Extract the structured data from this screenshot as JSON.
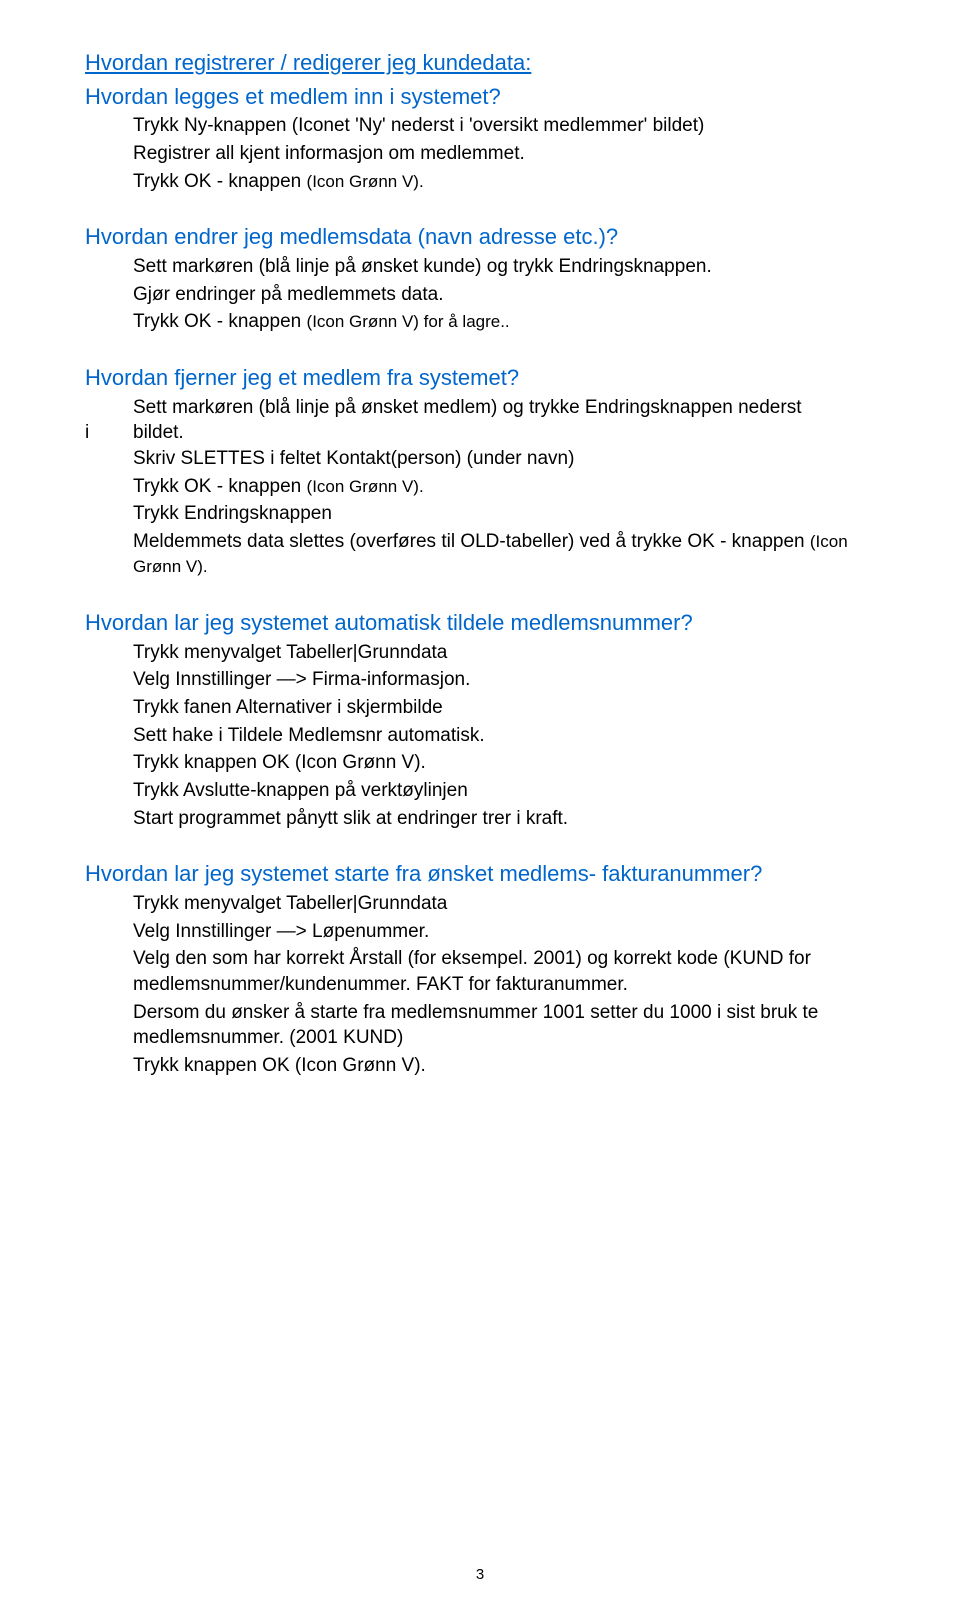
{
  "title": "Hvordan registrerer / redigerer jeg kundedata:",
  "sections": {
    "add": {
      "heading": "Hvordan legges et medlem inn i systemet?",
      "p1": "Trykk Ny-knappen (Iconet 'Ny' nederst i 'oversikt medlemmer' bildet)",
      "p2": "Registrer all kjent informasjon om medlemmet.",
      "p3_a": "Trykk OK - knappen ",
      "p3_b": "(Icon Grønn V)."
    },
    "edit": {
      "heading": "Hvordan endrer jeg medlemsdata (navn adresse etc.)?",
      "p1": "Sett markøren (blå  linje på ønsket kunde) og trykk  Endringsknappen.",
      "p2": "Gjør endringer på medlemmets data.",
      "p3_a": "Trykk OK - knappen ",
      "p3_b": "(Icon Grønn V) for å lagre.."
    },
    "remove": {
      "heading": "Hvordan fjerner jeg et medlem fra systemet?",
      "i_label": "i",
      "p1a": "Sett markøren (blå  linje på ønsket medlem) og trykke Endringsknappen nederst",
      "p1b": "bildet.",
      "p2": "Skriv SLETTES i feltet Kontakt(person) (under navn)",
      "p3_a": "Trykk OK - knappen ",
      "p3_b": "(Icon Grønn V).",
      "p4": "Trykk Endringsknappen",
      "p5_a": "Meldemmets data slettes (overføres til OLD-tabeller) ved å trykke OK - knappen ",
      "p5_b": "(Icon Grønn V)."
    },
    "autonumber": {
      "heading": "Hvordan lar jeg systemet automatisk tildele medlemsnummer?",
      "p1": "Trykk menyvalget Tabeller|Grunndata",
      "p2": "Velg Innstillinger —> Firma-informasjon.",
      "p3": "Trykk fanen Alternativer i skjermbilde",
      "p4": "Sett hake i Tildele Medlemsnr automatisk.",
      "p5": "Trykk knappen OK (Icon Grønn V).",
      "p6": "Trykk Avslutte-knappen på verktøylinjen",
      "p7": "Start programmet pånytt slik at endringer trer i kraft."
    },
    "startnumber": {
      "heading": "Hvordan lar jeg systemet starte fra ønsket medlems-  fakturanummer?",
      "p1": "Trykk menyvalget Tabeller|Grunndata",
      "p2": "Velg Innstillinger —> Løpenummer.",
      "p3": "Velg den som har korrekt Årstall (for eksempel. 2001) og korrekt kode (KUND for medlemsnummer/kundenummer. FAKT for fakturanummer.",
      "p4": "Dersom du ønsker å starte fra medlemsnummer 1001 setter du 1000 i sist bruk te medlemsnummer. (2001 KUND)",
      "p5": "Trykk knappen OK (Icon Grønn V)."
    }
  },
  "page_number": "3"
}
